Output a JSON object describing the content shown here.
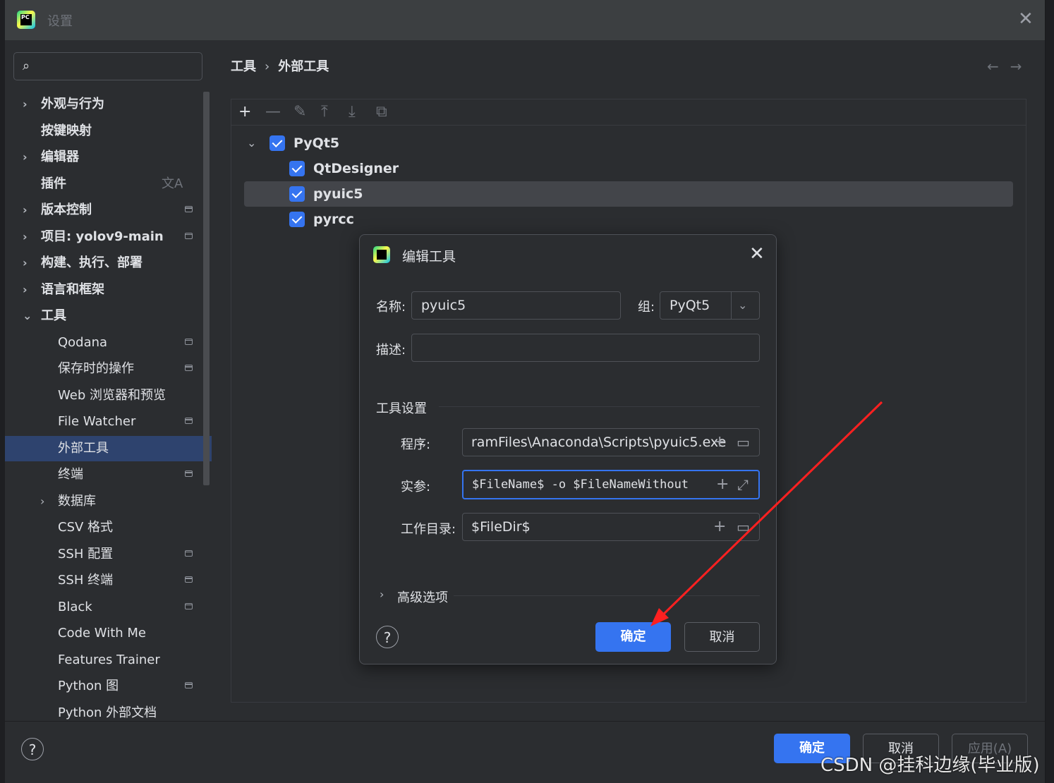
{
  "window": {
    "title": "设置",
    "logo_text": "PC"
  },
  "search": {
    "placeholder": "",
    "icon": "search-icon"
  },
  "sidebar": {
    "items": [
      {
        "label": "外观与行为",
        "expandable": true,
        "bold": true
      },
      {
        "label": "按键映射",
        "expandable": false,
        "bold": true
      },
      {
        "label": "编辑器",
        "expandable": true,
        "bold": true
      },
      {
        "label": "插件",
        "expandable": false,
        "bold": true,
        "badge": "translate-icon"
      },
      {
        "label": "版本控制",
        "expandable": true,
        "bold": true,
        "project": true
      },
      {
        "label": "项目: yolov9-main",
        "expandable": true,
        "bold": true,
        "project": true
      },
      {
        "label": "构建、执行、部署",
        "expandable": true,
        "bold": true
      },
      {
        "label": "语言和框架",
        "expandable": true,
        "bold": true
      },
      {
        "label": "工具",
        "expandable": true,
        "expanded": true,
        "bold": true
      },
      {
        "label": "Qodana",
        "child": true,
        "project": true
      },
      {
        "label": "保存时的操作",
        "child": true,
        "project": true
      },
      {
        "label": "Web 浏览器和预览",
        "child": true
      },
      {
        "label": "File Watcher",
        "child": true,
        "project": true
      },
      {
        "label": "外部工具",
        "child": true,
        "selected": true
      },
      {
        "label": "终端",
        "child": true,
        "project": true
      },
      {
        "label": "数据库",
        "child": true,
        "expandable": true
      },
      {
        "label": "CSV 格式",
        "child": true
      },
      {
        "label": "SSH 配置",
        "child": true,
        "project": true
      },
      {
        "label": "SSH 终端",
        "child": true,
        "project": true
      },
      {
        "label": "Black",
        "child": true,
        "project": true
      },
      {
        "label": "Code With Me",
        "child": true
      },
      {
        "label": "Features Trainer",
        "child": true
      },
      {
        "label": "Python 图",
        "child": true,
        "project": true
      },
      {
        "label": "Python 外部文档",
        "child": true
      }
    ]
  },
  "breadcrumb": {
    "parent": "工具",
    "separator": "›",
    "current": "外部工具"
  },
  "nav": {
    "back": "←",
    "forward": "→"
  },
  "toolbar": {
    "add": "+",
    "remove": "—",
    "edit": "✎",
    "up": "⤒",
    "down": "⤓",
    "copy": "⧉"
  },
  "tree": {
    "group": {
      "label": "PyQt5",
      "checked": true
    },
    "items": [
      {
        "label": "QtDesigner",
        "checked": true
      },
      {
        "label": "pyuic5",
        "checked": true,
        "selected": true
      },
      {
        "label": "pyrcc",
        "checked": true
      }
    ]
  },
  "dialog": {
    "title": "编辑工具",
    "name_label": "名称:",
    "name_value": "pyuic5",
    "group_label": "组:",
    "group_value": "PyQt5",
    "desc_label": "描述:",
    "desc_value": "",
    "section_title": "工具设置",
    "program_label": "程序:",
    "program_value": "ramFiles\\Anaconda\\Scripts\\pyuic5.exe",
    "args_label": "实参:",
    "args_value": "$FileName$ -o $FileNameWithout",
    "workdir_label": "工作目录:",
    "workdir_value": "$FileDir$",
    "advanced_label": "高级选项",
    "ok_label": "确定",
    "cancel_label": "取消",
    "help": "?"
  },
  "footer": {
    "help": "?",
    "ok_label": "确定",
    "cancel_label": "取消",
    "apply_label": "应用(A)"
  },
  "watermark": "CSDN @挂科边缘(毕业版)",
  "colors": {
    "accent": "#3574f0",
    "selection": "#2e436e",
    "annotation_arrow": "#ff2020"
  }
}
